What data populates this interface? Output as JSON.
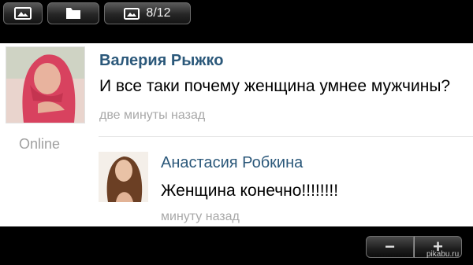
{
  "toolbar": {
    "crumbs": [
      {
        "icon": "image-icon"
      },
      {
        "icon": "folder-icon"
      },
      {
        "icon": "image-icon",
        "label": "8/12"
      }
    ]
  },
  "post": {
    "author": "Валерия Рыжко",
    "status": "Online",
    "message": "И все таки почему женщина умнее мужчины?",
    "time": "две минуты назад"
  },
  "reply": {
    "author": "Анастасия Робкина",
    "message": "Женщина конечно!!!!!!!!",
    "time": "минуту назад"
  },
  "zoom": {
    "out_label": "−",
    "in_label": "+"
  },
  "watermark": "pikabu.ru",
  "colors": {
    "name_link": "#2b587a",
    "meta_text": "#a8a8a8",
    "toolbar_bg": "#262626"
  }
}
